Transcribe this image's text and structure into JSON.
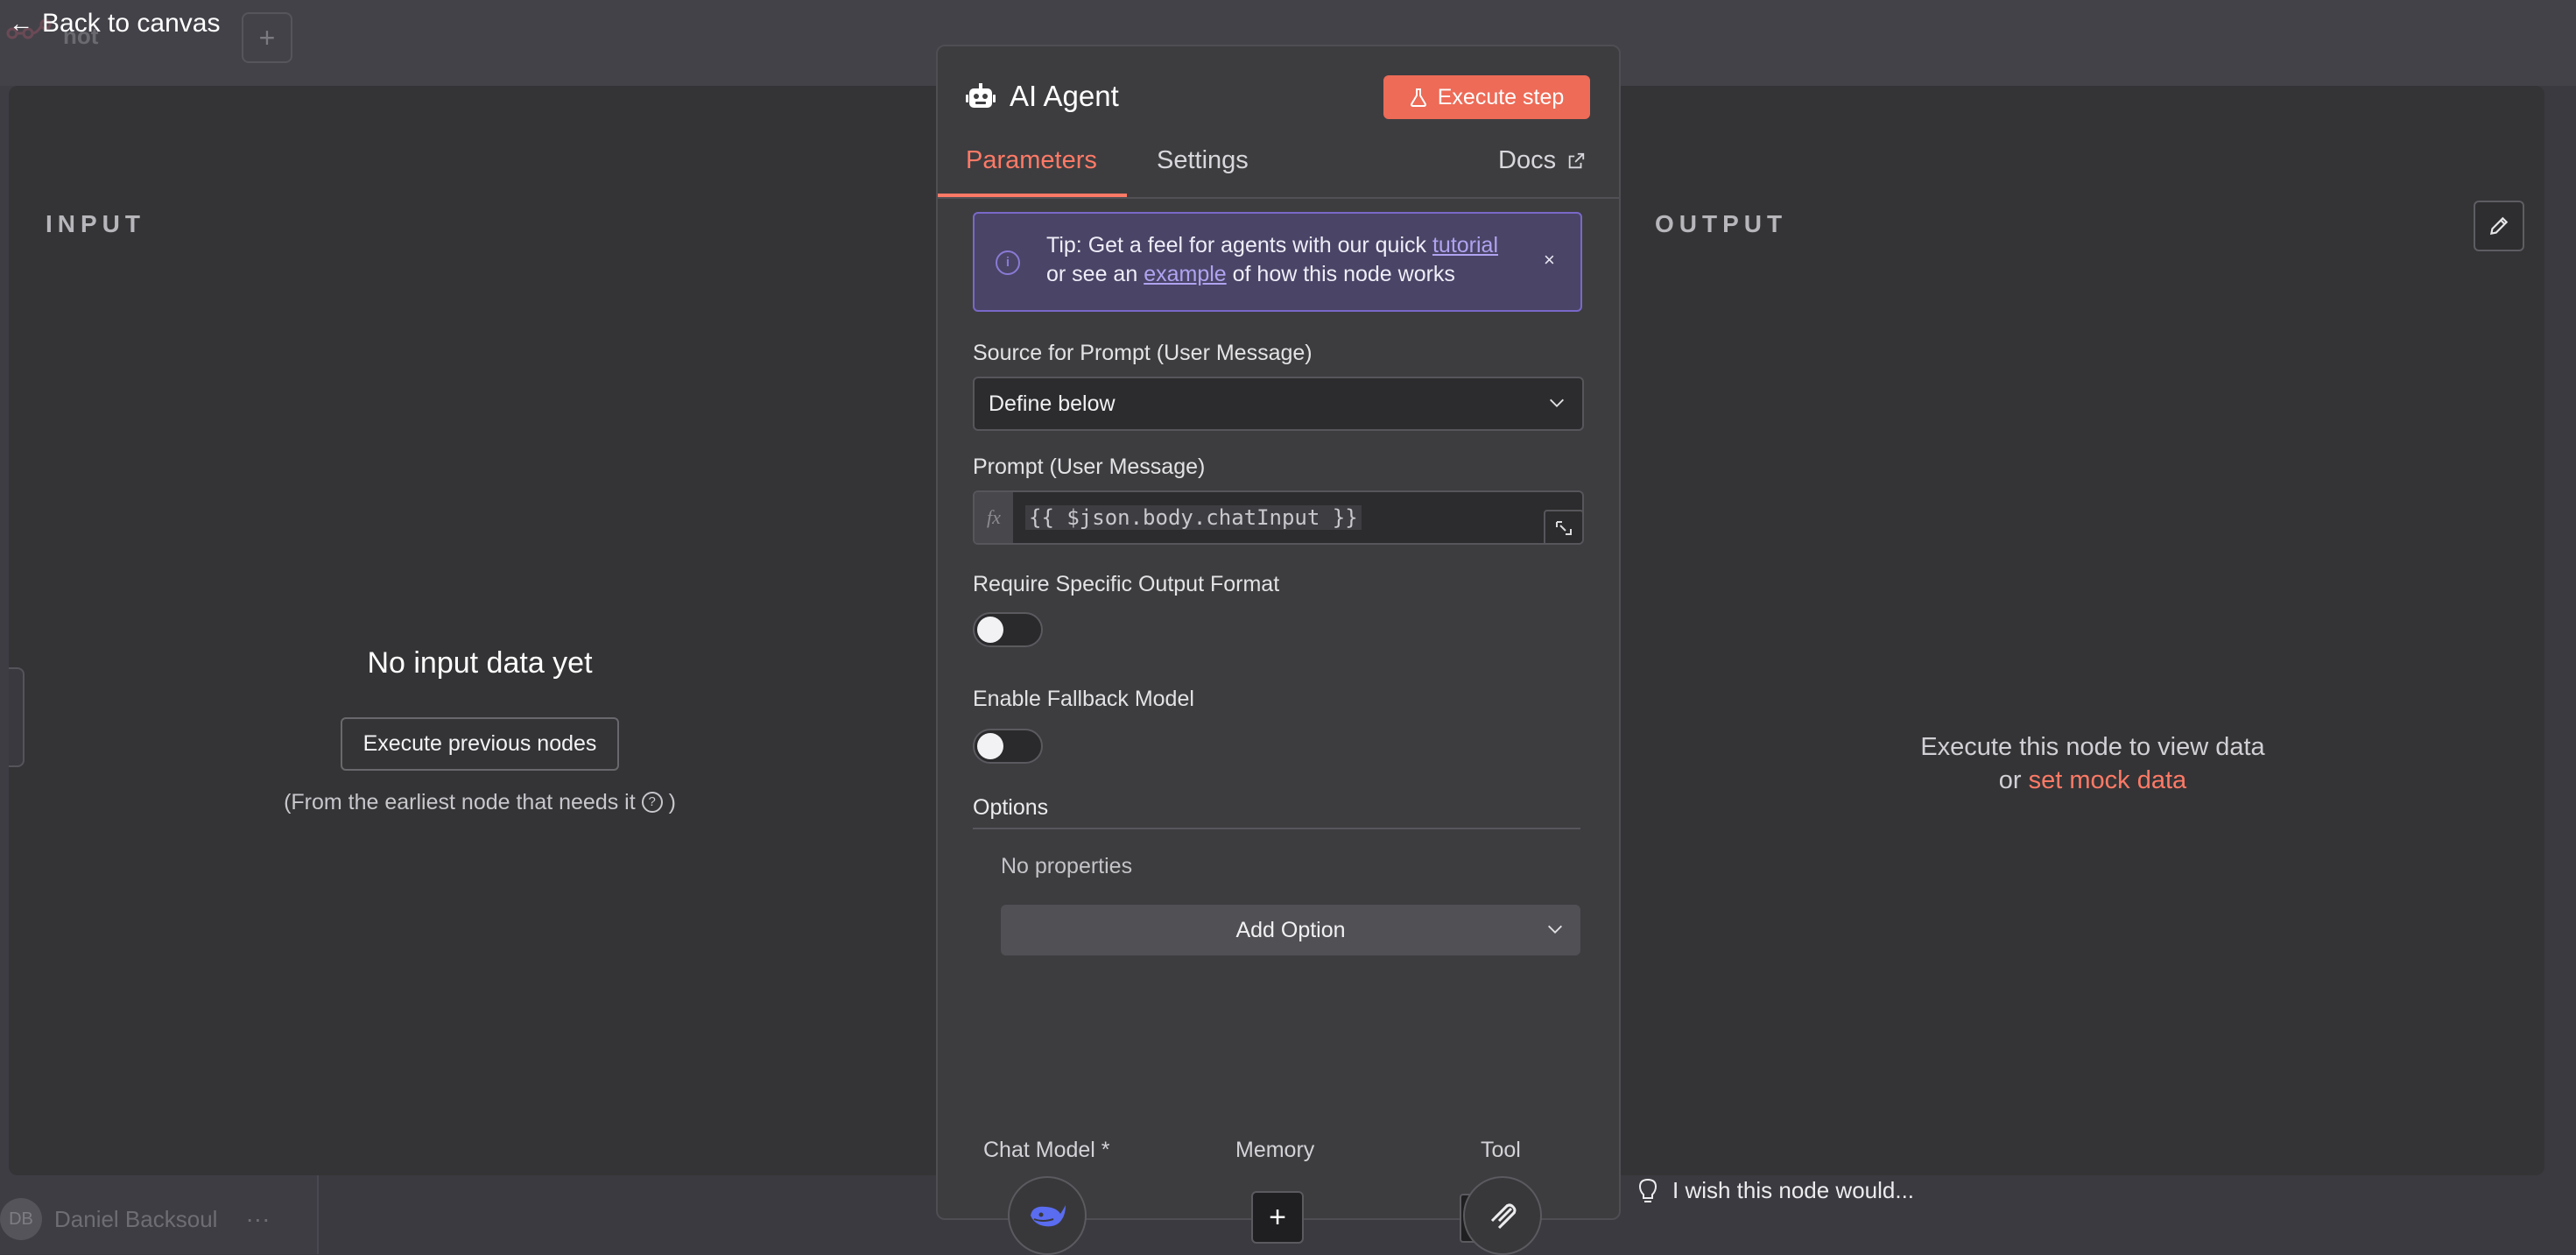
{
  "app": {
    "project_name": "not",
    "user_initials": "DB",
    "user_name": "Daniel Backsoul",
    "user_menu": "···",
    "new_tab": "+"
  },
  "nav": {
    "back_label": "Back to canvas",
    "back_icon": "arrow-left-icon"
  },
  "input_panel": {
    "title": "INPUT",
    "empty_title": "No input data yet",
    "execute_button": "Execute previous nodes",
    "hint_prefix": "(From the earliest node that needs it",
    "hint_suffix": ")",
    "help_glyph": "?"
  },
  "output_panel": {
    "title": "OUTPUT",
    "empty_line1": "Execute this node to view data",
    "empty_or": "or",
    "mock_link": "set mock data",
    "edit_icon": "pencil-icon"
  },
  "node": {
    "icon": "robot-icon",
    "title": "AI Agent",
    "execute_step": "Execute step",
    "tabs": {
      "parameters": "Parameters",
      "settings": "Settings",
      "docs": "Docs"
    },
    "tip": {
      "before": "Tip: Get a feel for agents with our quick ",
      "link1": "tutorial",
      "middle": "or see an ",
      "link2": "example",
      "after": " of how this node works",
      "close": "×",
      "info_glyph": "i"
    },
    "fields": {
      "source_label": "Source for Prompt (User Message)",
      "source_value": "Define below",
      "prompt_label": "Prompt (User Message)",
      "fx": "fx",
      "prompt_value": "{{ $json.body.chatInput }}",
      "output_format_label": "Require Specific Output Format",
      "output_format_on": false,
      "fallback_label": "Enable Fallback Model",
      "fallback_on": false
    },
    "options": {
      "title": "Options",
      "empty": "No properties",
      "add_button": "Add Option"
    },
    "sub_nodes": [
      {
        "label": "Chat Model *",
        "icon": "deepseek-whale-icon"
      },
      {
        "label": "Memory",
        "icon": "plus-icon",
        "button": "+"
      },
      {
        "label": "Tool",
        "icon": "tool-icon"
      }
    ]
  },
  "feedback": {
    "text": "I wish this node would...",
    "icon": "lightbulb-icon"
  },
  "colors": {
    "accent": "#ff7a66",
    "primary_button": "#ed6b57",
    "tip_bg": "#4a4466",
    "tip_border": "#7a68c9",
    "panel_bg": "#343436",
    "modal_bg": "#3d3d40"
  }
}
